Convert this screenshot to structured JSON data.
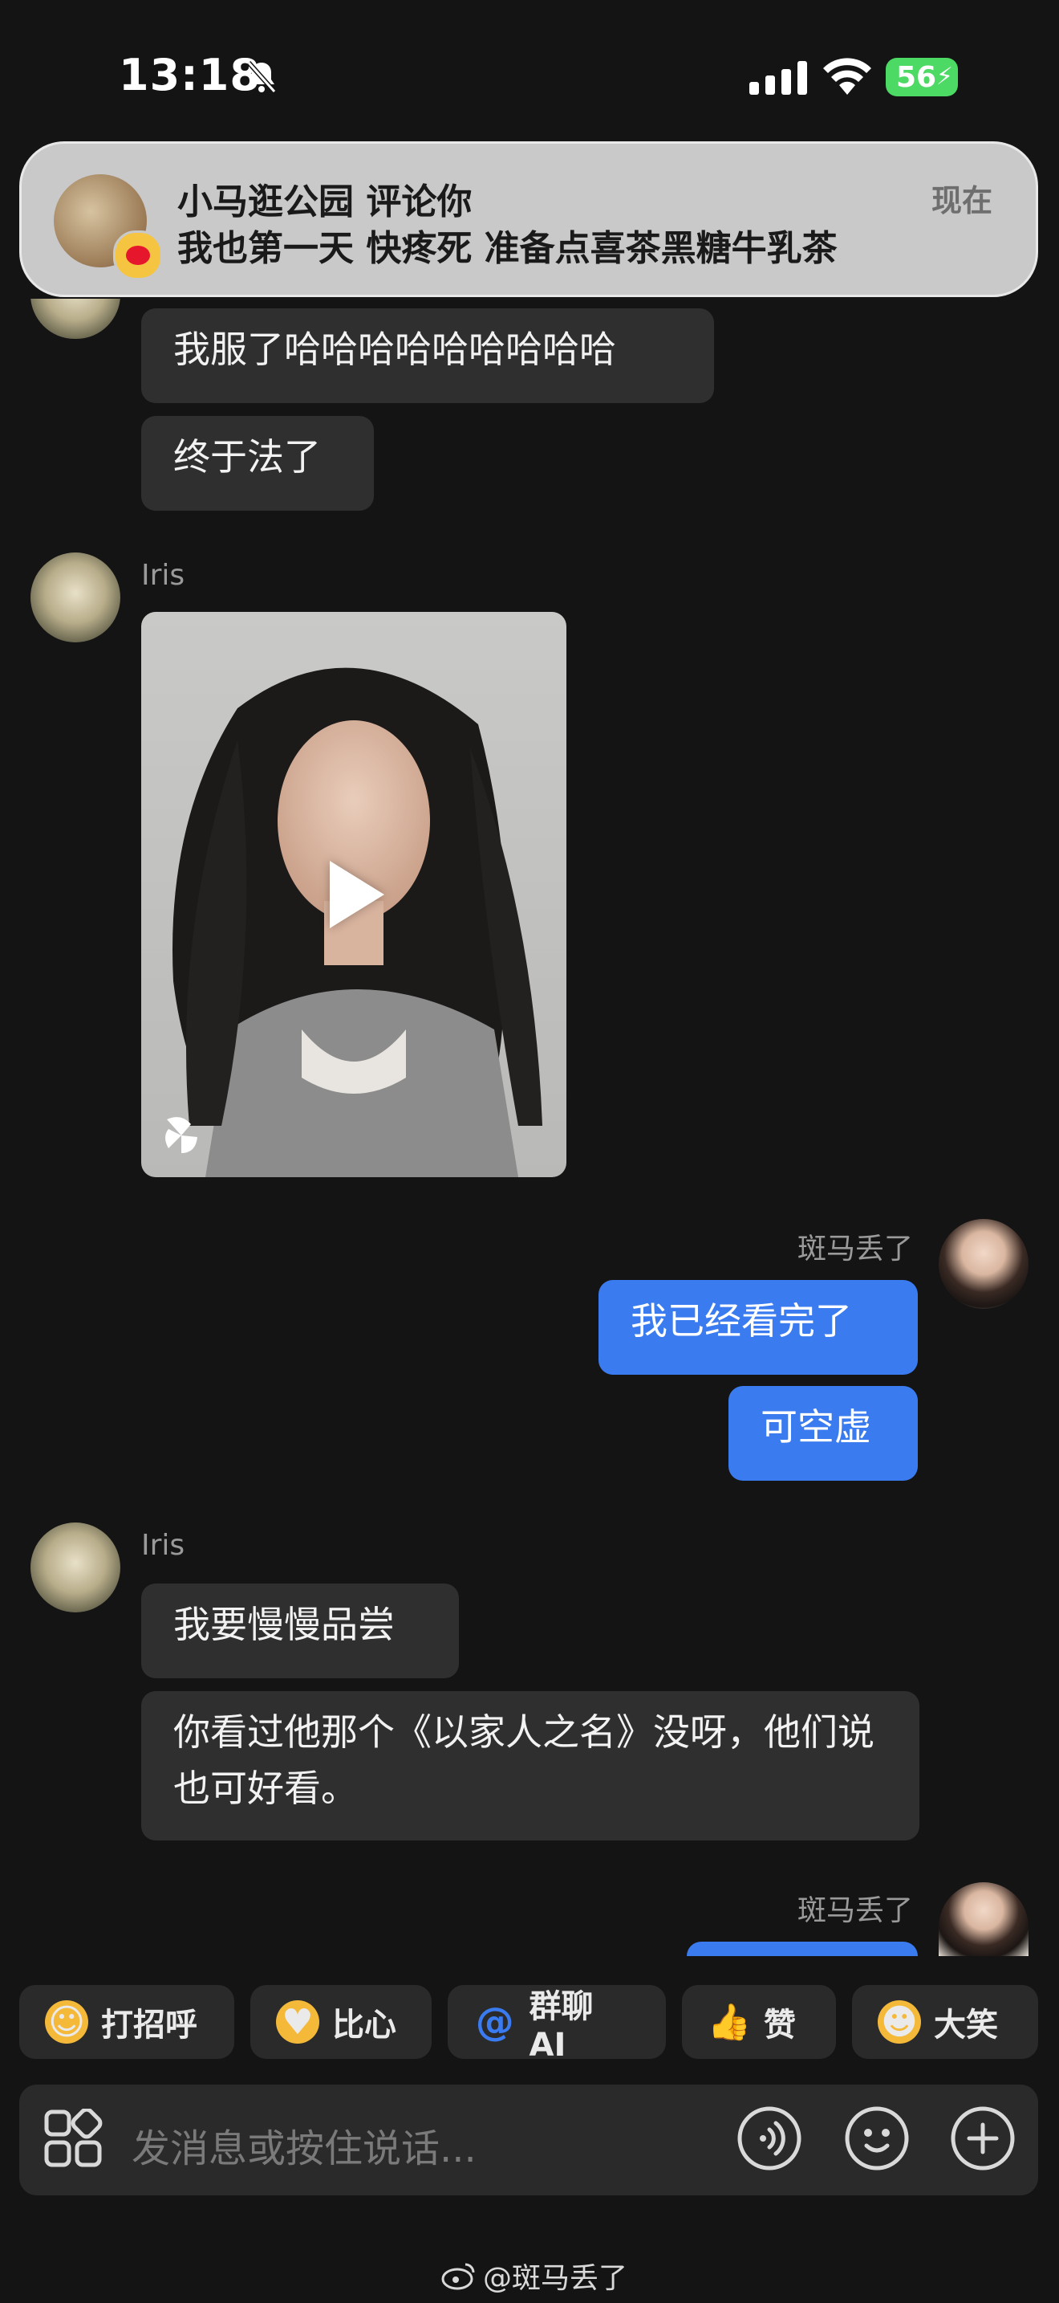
{
  "status_bar": {
    "time": "13:18",
    "battery": "56"
  },
  "notification": {
    "title": "小马逛公园 评论你",
    "body": "我也第一天 快疼死 准备点喜茶黑糖牛乳茶",
    "time": "现在",
    "app_icon": "weibo-icon"
  },
  "messages": {
    "m1": "我服了哈哈哈哈哈哈哈哈哈",
    "m2": "终于法了",
    "iris_name_1": "Iris",
    "me_name_1": "斑马丢了",
    "m3": "我已经看完了",
    "m4": "可空虚",
    "iris_name_2": "Iris",
    "m5": "我要慢慢品尝",
    "m6": "你看过他那个《以家人之名》没呀，他们说也可好看。",
    "me_name_2": "斑马丢了"
  },
  "quick_replies": [
    {
      "label": "打招呼",
      "icon": "wave-emoji-icon"
    },
    {
      "label": "比心",
      "icon": "heart-hand-emoji-icon"
    },
    {
      "label": "群聊 AI",
      "icon": "at-icon"
    },
    {
      "label": "赞",
      "icon": "thumbs-up-icon"
    },
    {
      "label": "大笑",
      "icon": "laugh-emoji-icon"
    }
  ],
  "input": {
    "placeholder": "发消息或按住说话..."
  },
  "watermark": "@斑马丢了",
  "colors": {
    "background": "#141414",
    "incoming_bubble": "#2f2f30",
    "outgoing_bubble": "#3a7bf0"
  }
}
